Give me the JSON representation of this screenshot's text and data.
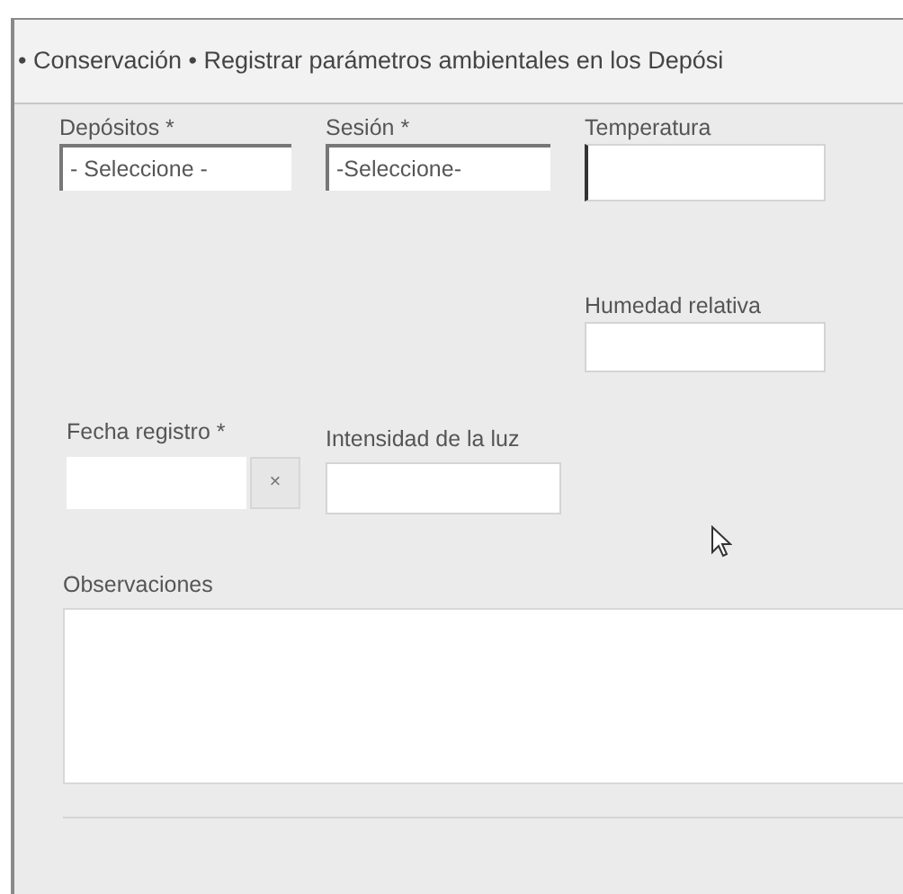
{
  "breadcrumb": "• Conservación • Registrar parámetros ambientales en los Depósi",
  "fields": {
    "depositos": {
      "label": "Depósitos *",
      "value": "- Seleccione -"
    },
    "sesion": {
      "label": "Sesión *",
      "value": "-Seleccione-"
    },
    "temperatura": {
      "label": "Temperatura",
      "focused": true
    },
    "humedad": {
      "label": "Humedad relativa"
    },
    "fecha": {
      "label": "Fecha registro *",
      "clear": "×"
    },
    "intensidad": {
      "label": "Intensidad de la luz"
    },
    "observaciones": {
      "label": "Observaciones"
    }
  }
}
